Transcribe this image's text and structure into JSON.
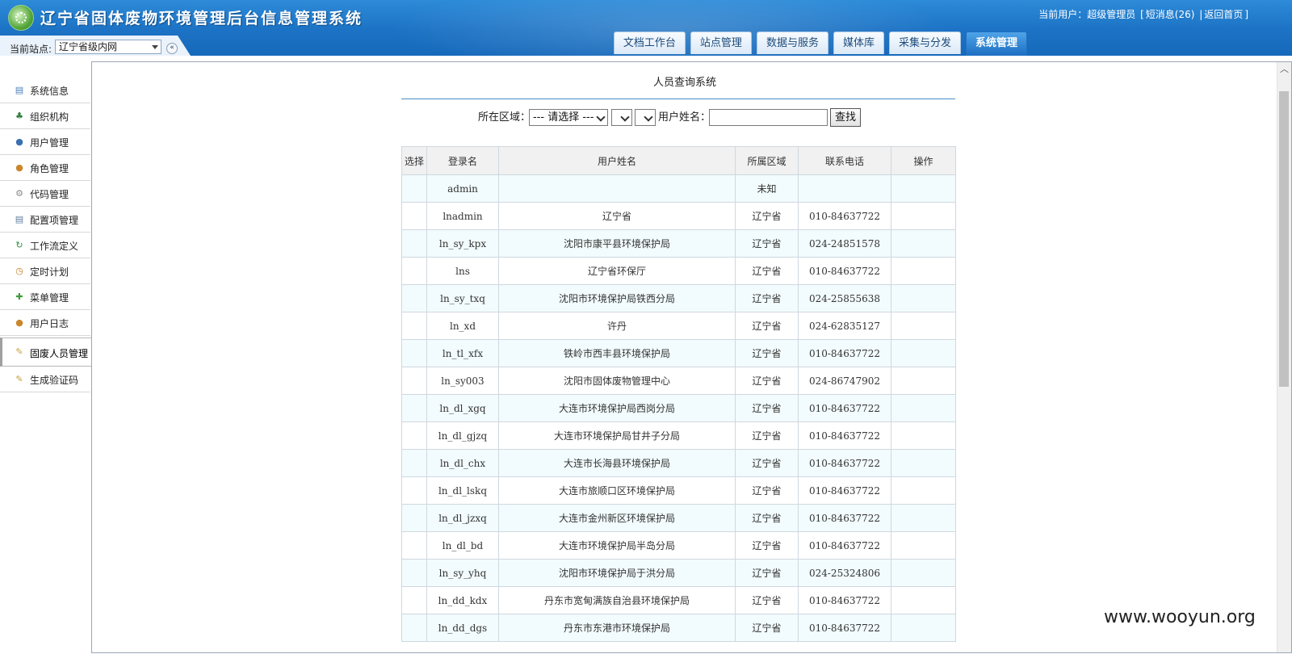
{
  "header": {
    "title": "辽宁省固体废物环境管理后台信息管理系统",
    "current_user_label": "当前用户：",
    "current_user": "超级管理员",
    "bracket_open": "[",
    "messages": "短消息(26)",
    "divider": "|",
    "home": "返回首页",
    "bracket_close": "]"
  },
  "station": {
    "label": "当前站点:",
    "value": "辽宁省级内网",
    "collapse_glyph": "«"
  },
  "tabs": [
    {
      "label": "文档工作台",
      "active": false
    },
    {
      "label": "站点管理",
      "active": false
    },
    {
      "label": "数据与服务",
      "active": false
    },
    {
      "label": "媒体库",
      "active": false
    },
    {
      "label": "采集与分发",
      "active": false
    },
    {
      "label": "系统管理",
      "active": true
    }
  ],
  "sidebar": {
    "items": [
      {
        "label": "系统信息",
        "icon": "info-window-icon",
        "glyph": "▤",
        "color": "#4a7fb8"
      },
      {
        "label": "组织机构",
        "icon": "org-chart-icon",
        "glyph": "♣",
        "color": "#2f7d3a"
      },
      {
        "label": "用户管理",
        "icon": "user-icon",
        "glyph": "●",
        "color": "#3a6fb0"
      },
      {
        "label": "角色管理",
        "icon": "role-users-icon",
        "glyph": "●",
        "color": "#c9862b"
      },
      {
        "label": "代码管理",
        "icon": "gears-icon",
        "glyph": "⚙",
        "color": "#8a8a8a"
      },
      {
        "label": "配置项管理",
        "icon": "config-list-icon",
        "glyph": "▤",
        "color": "#5f7f9e"
      },
      {
        "label": "工作流定义",
        "icon": "workflow-icon",
        "glyph": "↻",
        "color": "#2d8f3d"
      },
      {
        "label": "定时计划",
        "icon": "clock-icon",
        "glyph": "◷",
        "color": "#c47a1e"
      },
      {
        "label": "菜单管理",
        "icon": "puzzle-icon",
        "glyph": "✚",
        "color": "#3f9a3a"
      },
      {
        "label": "用户日志",
        "icon": "user-log-icon",
        "glyph": "●",
        "color": "#c9862b"
      },
      {
        "label": "固废人员管理",
        "icon": "notepad-icon",
        "glyph": "✎",
        "color": "#c9a13a",
        "active": true
      },
      {
        "label": "生成验证码",
        "icon": "notepad-icon",
        "glyph": "✎",
        "color": "#c9a13a"
      }
    ]
  },
  "main": {
    "page_title": "人员查询系统",
    "search": {
      "region_label": "所在区域：",
      "region_select": "--- 请选择 ---",
      "sub_select_1": "",
      "sub_select_2": "",
      "name_label": "用户姓名：",
      "name_value": "",
      "button": "查找"
    },
    "table": {
      "columns": [
        "选择",
        "登录名",
        "用户姓名",
        "所属区域",
        "联系电话",
        "操作"
      ],
      "rows": [
        [
          "",
          "admin",
          "",
          "未知",
          "",
          ""
        ],
        [
          "",
          "lnadmin",
          "辽宁省",
          "辽宁省",
          "010-84637722",
          ""
        ],
        [
          "",
          "ln_sy_kpx",
          "沈阳市康平县环境保护局",
          "辽宁省",
          "024-24851578",
          ""
        ],
        [
          "",
          "lns",
          "辽宁省环保厅",
          "辽宁省",
          "010-84637722",
          ""
        ],
        [
          "",
          "ln_sy_txq",
          "沈阳市环境保护局铁西分局",
          "辽宁省",
          "024-25855638",
          ""
        ],
        [
          "",
          "ln_xd",
          "许丹",
          "辽宁省",
          "024-62835127",
          ""
        ],
        [
          "",
          "ln_tl_xfx",
          "铁岭市西丰县环境保护局",
          "辽宁省",
          "010-84637722",
          ""
        ],
        [
          "",
          "ln_sy003",
          "沈阳市固体废物管理中心",
          "辽宁省",
          "024-86747902",
          ""
        ],
        [
          "",
          "ln_dl_xgq",
          "大连市环境保护局西岗分局",
          "辽宁省",
          "010-84637722",
          ""
        ],
        [
          "",
          "ln_dl_gjzq",
          "大连市环境保护局甘井子分局",
          "辽宁省",
          "010-84637722",
          ""
        ],
        [
          "",
          "ln_dl_chx",
          "大连市长海县环境保护局",
          "辽宁省",
          "010-84637722",
          ""
        ],
        [
          "",
          "ln_dl_lskq",
          "大连市旅顺口区环境保护局",
          "辽宁省",
          "010-84637722",
          ""
        ],
        [
          "",
          "ln_dl_jzxq",
          "大连市金州新区环境保护局",
          "辽宁省",
          "010-84637722",
          ""
        ],
        [
          "",
          "ln_dl_bd",
          "大连市环境保护局半岛分局",
          "辽宁省",
          "010-84637722",
          ""
        ],
        [
          "",
          "ln_sy_yhq",
          "沈阳市环境保护局于洪分局",
          "辽宁省",
          "024-25324806",
          ""
        ],
        [
          "",
          "ln_dd_kdx",
          "丹东市宽甸满族自治县环境保护局",
          "辽宁省",
          "010-84637722",
          ""
        ],
        [
          "",
          "ln_dd_dgs",
          "丹东市东港市环境保护局",
          "辽宁省",
          "010-84637722",
          ""
        ]
      ]
    }
  },
  "watermark": "www.wooyun.org"
}
